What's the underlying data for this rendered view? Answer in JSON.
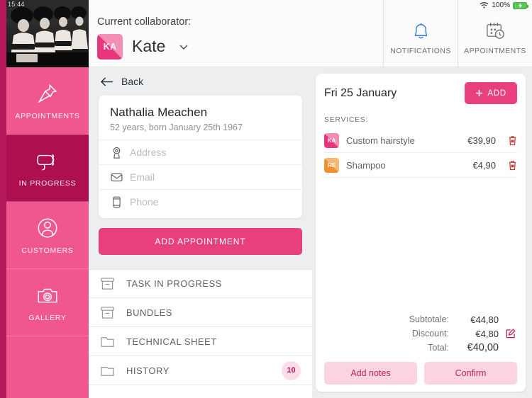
{
  "status_bar": {
    "time": "15:44",
    "wifi_icon": "wifi-icon",
    "battery_percent": "100%",
    "battery_icon": "battery-charging-icon"
  },
  "rail": {
    "photo_alt": "vintage-salon-hairdryers-photo",
    "items": [
      {
        "label": "APPOINTMENTS",
        "icon": "pin-icon",
        "active": false
      },
      {
        "label": "IN PROGRESS",
        "icon": "hairdryer-icon",
        "active": true
      },
      {
        "label": "CUSTOMERS",
        "icon": "person-circle-icon",
        "active": false
      },
      {
        "label": "GALLERY",
        "icon": "camera-icon",
        "active": false
      }
    ]
  },
  "header": {
    "collaborator_label": "Current collaborator:",
    "collaborator_name": "Kate",
    "collaborator_initials": "KA",
    "chevron_icon": "chevron-down-icon",
    "buttons": [
      {
        "label": "NOTIFICATIONS",
        "icon": "bell-icon",
        "color": "#2f7de1"
      },
      {
        "label": "APPOINTMENTS",
        "icon": "calendar-clock-icon",
        "color": "#6c7075"
      }
    ]
  },
  "center": {
    "back_label": "Back",
    "back_icon": "arrow-left-icon",
    "customer": {
      "name": "Nathalia Meachen",
      "subtitle": "52 years, born January 25th 1967",
      "fields": [
        {
          "icon": "location-pin-icon",
          "placeholder": "Address",
          "value": ""
        },
        {
          "icon": "envelope-icon",
          "placeholder": "Email",
          "value": ""
        },
        {
          "icon": "phone-icon",
          "placeholder": "Phone",
          "value": ""
        }
      ]
    },
    "add_appointment_label": "ADD APPOINTMENT",
    "menu": [
      {
        "label": "TASK IN PROGRESS",
        "icon": "archive-box-icon",
        "badge": ""
      },
      {
        "label": "BUNDLES",
        "icon": "archive-box-icon",
        "badge": ""
      },
      {
        "label": "TECHNICAL SHEET",
        "icon": "folder-icon",
        "badge": ""
      },
      {
        "label": "HISTORY",
        "icon": "folder-icon",
        "badge": "10"
      }
    ]
  },
  "right_panel": {
    "date": "Fri 25 January",
    "add_label": "ADD",
    "add_icon": "plus-icon",
    "services_title": "SERVICES:",
    "services": [
      {
        "initials": "KA",
        "avatar_color": "pink",
        "name": "Custom hairstyle",
        "price": "€39,90",
        "delete_icon": "trash-icon"
      },
      {
        "initials": "RE",
        "avatar_color": "orange",
        "name": "Shampoo",
        "price": "€4,90",
        "delete_icon": "trash-icon"
      }
    ],
    "totals": [
      {
        "label": "Subtotale:",
        "value": "€44,80",
        "edit": false
      },
      {
        "label": "Discount:",
        "value": "€4,80",
        "edit": true,
        "edit_icon": "edit-pencil-icon"
      },
      {
        "label": "Total:",
        "value": "€40,00",
        "edit": false
      }
    ],
    "buttons": [
      {
        "label": "Add notes"
      },
      {
        "label": "Confirm"
      }
    ]
  },
  "colors": {
    "brand_pink": "#e8407f",
    "rail_pink": "#f0568f",
    "rail_active": "#ad0f4f",
    "rail_edge": "#b5195b",
    "notification_blue": "#2f7de1",
    "badge_bg": "#fbdce8",
    "soft_pink": "#fbd3e1",
    "trash_red": "#c0392b"
  }
}
